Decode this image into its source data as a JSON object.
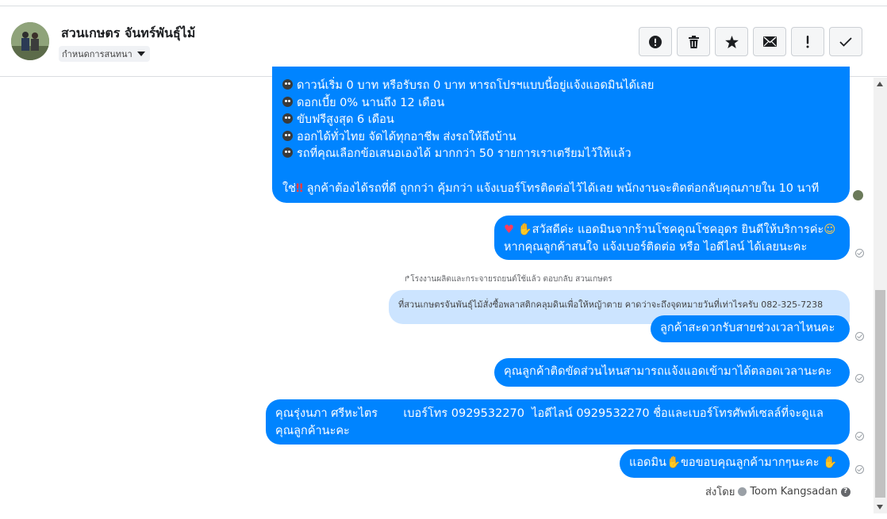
{
  "header": {
    "contact_name": "สวนเกษตร จันทร์พันธุ์ไม้",
    "assign_label": "กำหนดการสนทนา",
    "toolbar": [
      {
        "name": "report-spam-button",
        "icon": "exclamation-circle-icon"
      },
      {
        "name": "delete-button",
        "icon": "trash-icon"
      },
      {
        "name": "star-button",
        "icon": "star-icon"
      },
      {
        "name": "mark-unread-button",
        "icon": "envelope-icon"
      },
      {
        "name": "follow-up-button",
        "icon": "exclamation-icon"
      },
      {
        "name": "mark-done-button",
        "icon": "check-icon"
      }
    ]
  },
  "conversation": {
    "message1": {
      "lines": [
        "ดาวน์เริ่ม 0 บาท หรือรับรถ 0 บาท หารถโปรฯแบบนี้อยู่แจ้งแอดมินได้เลย",
        "ดอกเบี้ย 0% นานถึง 12 เดือน",
        "ขับฟรีสูงสุด 6 เดือน",
        "ออกได้ทั่วไทย จัดได้ทุกอาชีพ ส่งรถให้ถึงบ้าน",
        "รถที่คุณเลือกข้อเสนอเองได้ มากกว่า 50 รายการเราเตรียมไว้ให้แล้ว"
      ],
      "closing_prefix": "ใช่",
      "closing_text": "ลูกค้าต้องได้รถที่ดี ถูกกว่า คุ้มกว่า แจ้งเบอร์โทรติดต่อไว้ได้เลย พนักงานจะติดต่อกลับคุณภายใน 10 นาที"
    },
    "message2": {
      "line1": "สวัสดีค่ะ แอดมินจากร้านโชคคูณโชคอุดร ยินดีให้บริการค่ะ",
      "line2": "หากคุณลูกค้าสนใจ แจ้งเบอร์ติดต่อ หรือ ไอดีไลน์ ได้เลยนะคะ"
    },
    "reply_context": "โรงงานผลิตและกระจายรถยนต์ใช้แล้ว ตอบกลับ สวนเกษตร",
    "quoted_message": "ที่สวนเกษตรจันพันธุ์ไม้สั่งซื้อพลาสติกคลุมดินเพื่อให้หญ้าตาย คาดว่าจะถึงจุดหมายวันที่เท่าไรครับ 082-325-7238",
    "message3": "ลูกค้าสะดวกรับสายช่วงเวลาไหนคะ",
    "message4": "คุณลูกค้าติดขัดส่วนไหนสามารถแจ้งแอดเข้ามาได้ตลอดเวลานะคะ",
    "message5": {
      "line1": "คุณรุ่งนภา ศรีหะไตร       เบอร์โทร 0929532270  ไอดีไลน์ 0929532270 ชื่อและเบอร์โทรศัพท์เซลล์ที่จะดูแล",
      "line2": "คุณลูกค้านะคะ"
    },
    "message6": {
      "prefix": "แอดมิน",
      "text": "ขอขอบคุณลูกค้ามากๆนะคะ"
    },
    "sent_by_label": "ส่งโดย",
    "sent_by_name": "Toom Kangsadan"
  },
  "colors": {
    "bubble_blue": "#0084ff",
    "quoted_bg": "#cce4ff"
  }
}
